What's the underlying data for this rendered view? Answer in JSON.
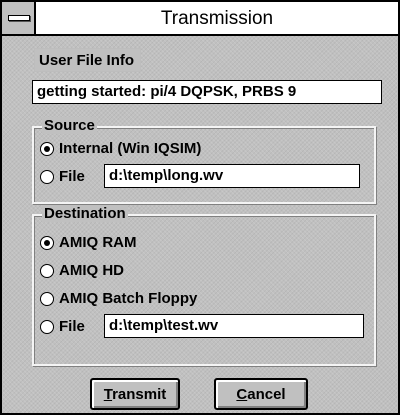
{
  "window": {
    "title": "Transmission"
  },
  "user_file_info": {
    "label": "User File Info",
    "value": "getting started: pi/4 DQPSK, PRBS 9"
  },
  "source": {
    "title": "Source",
    "options": [
      {
        "label": "Internal (Win IQSIM)",
        "selected": true
      },
      {
        "label": "File",
        "selected": false
      }
    ],
    "file_path": "d:\\temp\\long.wv"
  },
  "destination": {
    "title": "Destination",
    "options": [
      {
        "label": "AMIQ RAM",
        "selected": true
      },
      {
        "label": "AMIQ HD",
        "selected": false
      },
      {
        "label": "AMIQ Batch Floppy",
        "selected": false
      },
      {
        "label": "File",
        "selected": false
      }
    ],
    "file_path": "d:\\temp\\test.wv"
  },
  "buttons": {
    "transmit": {
      "mnemonic": "T",
      "rest": "ransmit"
    },
    "cancel": {
      "mnemonic": "C",
      "rest": "ancel"
    }
  },
  "icons": {
    "system_menu": "system-menu-icon"
  }
}
